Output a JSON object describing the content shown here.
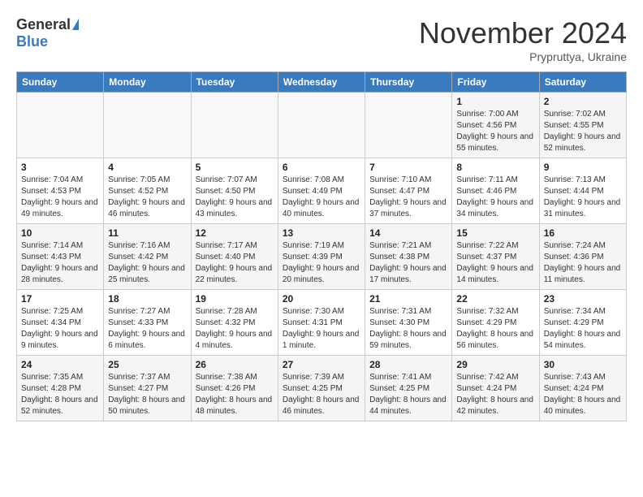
{
  "logo": {
    "general": "General",
    "blue": "Blue"
  },
  "header": {
    "month": "November 2024",
    "location": "Prypruttya, Ukraine"
  },
  "weekdays": [
    "Sunday",
    "Monday",
    "Tuesday",
    "Wednesday",
    "Thursday",
    "Friday",
    "Saturday"
  ],
  "weeks": [
    [
      {
        "day": "",
        "info": ""
      },
      {
        "day": "",
        "info": ""
      },
      {
        "day": "",
        "info": ""
      },
      {
        "day": "",
        "info": ""
      },
      {
        "day": "",
        "info": ""
      },
      {
        "day": "1",
        "info": "Sunrise: 7:00 AM\nSunset: 4:56 PM\nDaylight: 9 hours and 55 minutes."
      },
      {
        "day": "2",
        "info": "Sunrise: 7:02 AM\nSunset: 4:55 PM\nDaylight: 9 hours and 52 minutes."
      }
    ],
    [
      {
        "day": "3",
        "info": "Sunrise: 7:04 AM\nSunset: 4:53 PM\nDaylight: 9 hours and 49 minutes."
      },
      {
        "day": "4",
        "info": "Sunrise: 7:05 AM\nSunset: 4:52 PM\nDaylight: 9 hours and 46 minutes."
      },
      {
        "day": "5",
        "info": "Sunrise: 7:07 AM\nSunset: 4:50 PM\nDaylight: 9 hours and 43 minutes."
      },
      {
        "day": "6",
        "info": "Sunrise: 7:08 AM\nSunset: 4:49 PM\nDaylight: 9 hours and 40 minutes."
      },
      {
        "day": "7",
        "info": "Sunrise: 7:10 AM\nSunset: 4:47 PM\nDaylight: 9 hours and 37 minutes."
      },
      {
        "day": "8",
        "info": "Sunrise: 7:11 AM\nSunset: 4:46 PM\nDaylight: 9 hours and 34 minutes."
      },
      {
        "day": "9",
        "info": "Sunrise: 7:13 AM\nSunset: 4:44 PM\nDaylight: 9 hours and 31 minutes."
      }
    ],
    [
      {
        "day": "10",
        "info": "Sunrise: 7:14 AM\nSunset: 4:43 PM\nDaylight: 9 hours and 28 minutes."
      },
      {
        "day": "11",
        "info": "Sunrise: 7:16 AM\nSunset: 4:42 PM\nDaylight: 9 hours and 25 minutes."
      },
      {
        "day": "12",
        "info": "Sunrise: 7:17 AM\nSunset: 4:40 PM\nDaylight: 9 hours and 22 minutes."
      },
      {
        "day": "13",
        "info": "Sunrise: 7:19 AM\nSunset: 4:39 PM\nDaylight: 9 hours and 20 minutes."
      },
      {
        "day": "14",
        "info": "Sunrise: 7:21 AM\nSunset: 4:38 PM\nDaylight: 9 hours and 17 minutes."
      },
      {
        "day": "15",
        "info": "Sunrise: 7:22 AM\nSunset: 4:37 PM\nDaylight: 9 hours and 14 minutes."
      },
      {
        "day": "16",
        "info": "Sunrise: 7:24 AM\nSunset: 4:36 PM\nDaylight: 9 hours and 11 minutes."
      }
    ],
    [
      {
        "day": "17",
        "info": "Sunrise: 7:25 AM\nSunset: 4:34 PM\nDaylight: 9 hours and 9 minutes."
      },
      {
        "day": "18",
        "info": "Sunrise: 7:27 AM\nSunset: 4:33 PM\nDaylight: 9 hours and 6 minutes."
      },
      {
        "day": "19",
        "info": "Sunrise: 7:28 AM\nSunset: 4:32 PM\nDaylight: 9 hours and 4 minutes."
      },
      {
        "day": "20",
        "info": "Sunrise: 7:30 AM\nSunset: 4:31 PM\nDaylight: 9 hours and 1 minute."
      },
      {
        "day": "21",
        "info": "Sunrise: 7:31 AM\nSunset: 4:30 PM\nDaylight: 8 hours and 59 minutes."
      },
      {
        "day": "22",
        "info": "Sunrise: 7:32 AM\nSunset: 4:29 PM\nDaylight: 8 hours and 56 minutes."
      },
      {
        "day": "23",
        "info": "Sunrise: 7:34 AM\nSunset: 4:29 PM\nDaylight: 8 hours and 54 minutes."
      }
    ],
    [
      {
        "day": "24",
        "info": "Sunrise: 7:35 AM\nSunset: 4:28 PM\nDaylight: 8 hours and 52 minutes."
      },
      {
        "day": "25",
        "info": "Sunrise: 7:37 AM\nSunset: 4:27 PM\nDaylight: 8 hours and 50 minutes."
      },
      {
        "day": "26",
        "info": "Sunrise: 7:38 AM\nSunset: 4:26 PM\nDaylight: 8 hours and 48 minutes."
      },
      {
        "day": "27",
        "info": "Sunrise: 7:39 AM\nSunset: 4:25 PM\nDaylight: 8 hours and 46 minutes."
      },
      {
        "day": "28",
        "info": "Sunrise: 7:41 AM\nSunset: 4:25 PM\nDaylight: 8 hours and 44 minutes."
      },
      {
        "day": "29",
        "info": "Sunrise: 7:42 AM\nSunset: 4:24 PM\nDaylight: 8 hours and 42 minutes."
      },
      {
        "day": "30",
        "info": "Sunrise: 7:43 AM\nSunset: 4:24 PM\nDaylight: 8 hours and 40 minutes."
      }
    ]
  ]
}
